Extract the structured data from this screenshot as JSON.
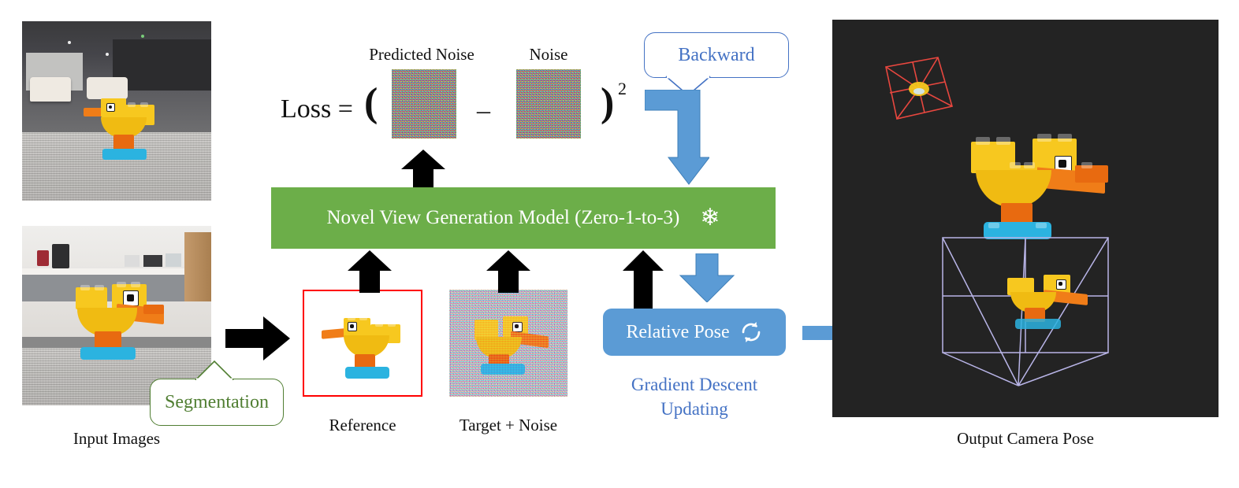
{
  "figure": {
    "title": "Pose estimation via novel view generation diagram"
  },
  "inputs": {
    "label": "Input Images",
    "images": [
      {
        "name": "lego-duck-office-lounge",
        "scene": "office lounge with white armchairs"
      },
      {
        "name": "lego-duck-pantry",
        "scene": "office pantry with coffee machine"
      }
    ],
    "segmentation_callout": "Segmentation"
  },
  "pipeline": {
    "reference_label": "Reference",
    "target_label": "Target + Noise",
    "model_box": {
      "label": "Novel View Generation Model (Zero-1-to-3)",
      "frozen_icon": "snowflake-icon",
      "color": "#6CAE49"
    },
    "pose_button": {
      "label": "Relative Pose",
      "icon": "refresh-cycle-icon",
      "color": "#5B9BD5"
    },
    "gradient_text_line1": "Gradient Descent",
    "gradient_text_line2": "Updating",
    "backward_callout": "Backward"
  },
  "loss": {
    "prefix": "Loss =",
    "open_paren": "(",
    "predicted_noise_label": "Predicted Noise",
    "operator": "–",
    "noise_label": "Noise",
    "close_paren": ")",
    "exponent": "2"
  },
  "output": {
    "label": "Output Camera Pose",
    "reference_frustum_color": "#e8473f",
    "estimated_frustum_color": "#b9b5e8",
    "background": "#232323"
  },
  "colors": {
    "green": "#6CAE49",
    "blue": "#5B9BD5",
    "blue_text": "#4472C4",
    "green_text": "#507E32",
    "red_border": "#ff0000",
    "black": "#000000"
  }
}
